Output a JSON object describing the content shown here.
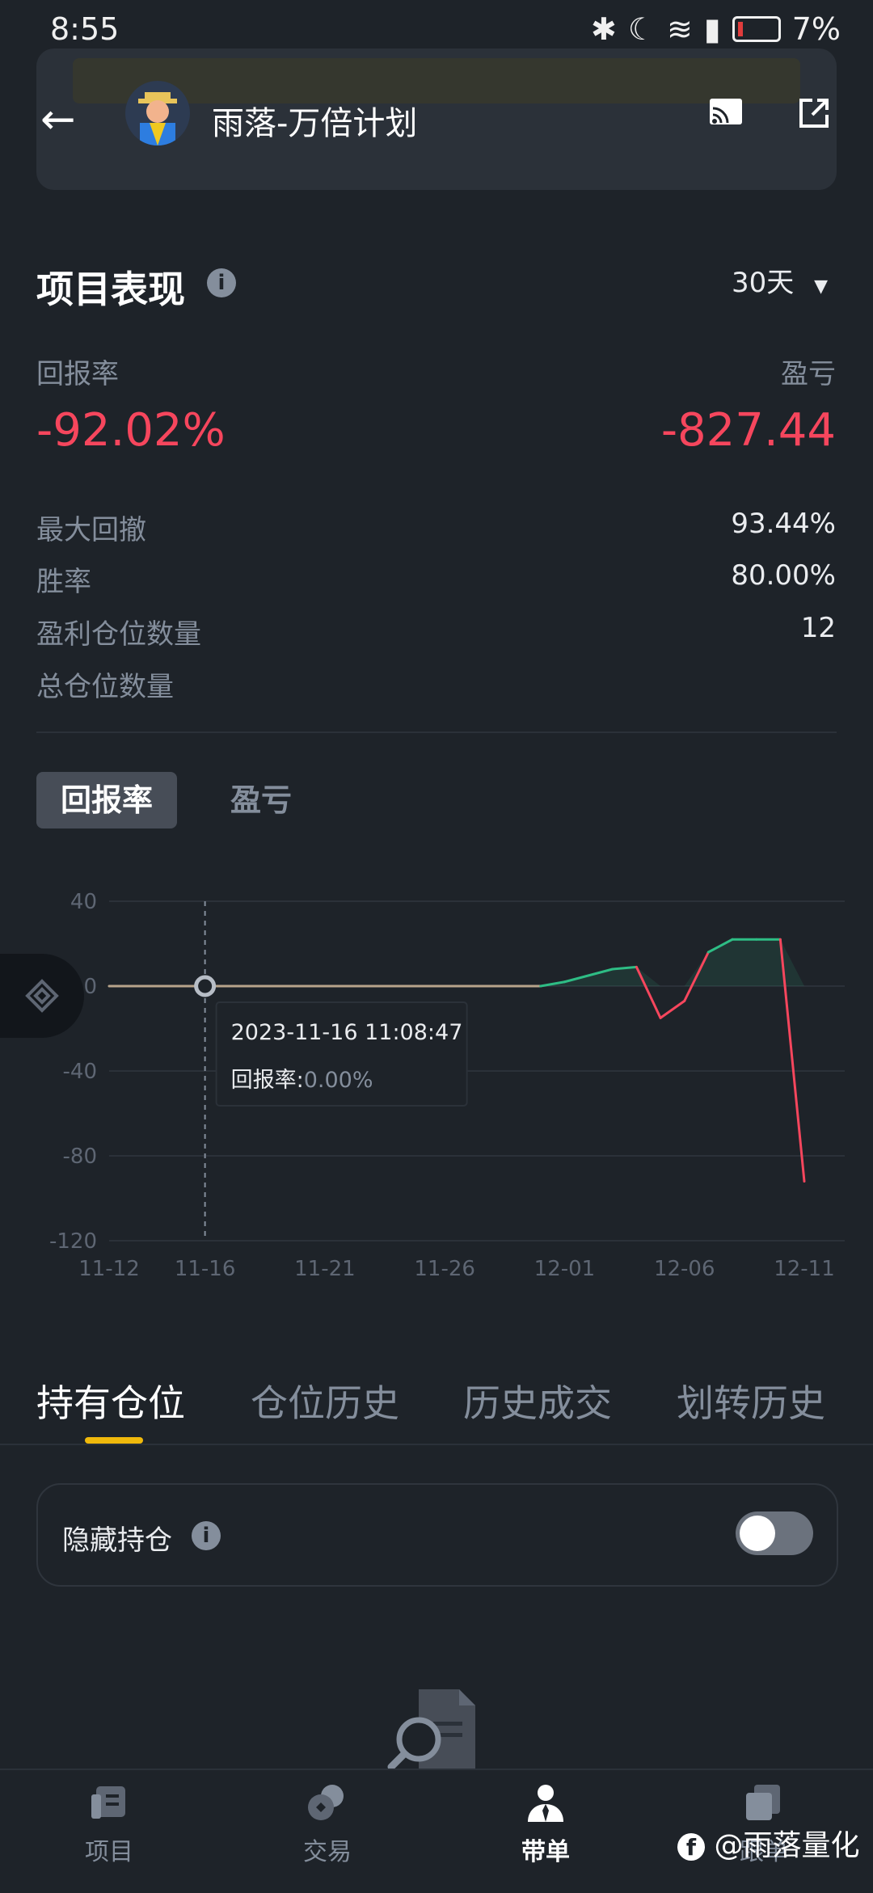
{
  "status_bar": {
    "time": "8:55",
    "battery": "7%"
  },
  "header": {
    "title": "雨落-万倍计划"
  },
  "performance": {
    "title": "项目表现",
    "period": "30天",
    "return_label": "回报率",
    "pnl_label": "盈亏",
    "return_value": "-92.02%",
    "pnl_value": "-827.44",
    "stats": [
      {
        "label": "最大回撤",
        "value": "93.44%"
      },
      {
        "label": "胜率",
        "value": "80.00%"
      },
      {
        "label": "盈利仓位数量",
        "value": "12"
      },
      {
        "label": "总仓位数量",
        "value": ""
      }
    ]
  },
  "chart_tabs": {
    "active": "回报率",
    "inactive": "盈亏"
  },
  "chart_data": {
    "type": "line",
    "x": [
      "11-12",
      "11-14",
      "11-16",
      "11-18",
      "11-20",
      "11-22",
      "11-24",
      "11-26",
      "11-28",
      "11-30",
      "12-01",
      "12-03",
      "12-04",
      "12-05",
      "12-06",
      "12-07",
      "12-08",
      "12-09",
      "12-10",
      "12-11"
    ],
    "series": [
      {
        "values": [
          0,
          0,
          0,
          0,
          0,
          0,
          0,
          0,
          0,
          0,
          2,
          8,
          9,
          -15,
          -7,
          16,
          22,
          22,
          22,
          -92.02
        ]
      }
    ],
    "xticks": [
      "11-12",
      "11-16",
      "11-21",
      "11-26",
      "12-01",
      "12-06",
      "12-11"
    ],
    "yticks": [
      "40",
      "0",
      "-40",
      "-80",
      "-120"
    ],
    "ylim": [
      -120,
      40
    ],
    "tooltip": {
      "date": "2023-11-16 11:08:47",
      "label": "回报率:",
      "value": "0.00%"
    },
    "colors": {
      "positive": "#2ebd85",
      "negative": "#f6465d",
      "flat": "#b7a38a"
    }
  },
  "position_tabs": {
    "items": [
      "持有仓位",
      "仓位历史",
      "历史成交",
      "划转历史"
    ],
    "active_index": 0
  },
  "hide_positions": {
    "label": "隐藏持仓",
    "enabled": false
  },
  "bottom_nav": [
    {
      "label": "项目",
      "icon": "project-icon"
    },
    {
      "label": "交易",
      "icon": "trade-icon"
    },
    {
      "label": "带单",
      "icon": "lead-trade-icon",
      "active": true
    },
    {
      "label": "跟单",
      "icon": "copy-trade-icon"
    }
  ],
  "watermark": "@雨落量化"
}
